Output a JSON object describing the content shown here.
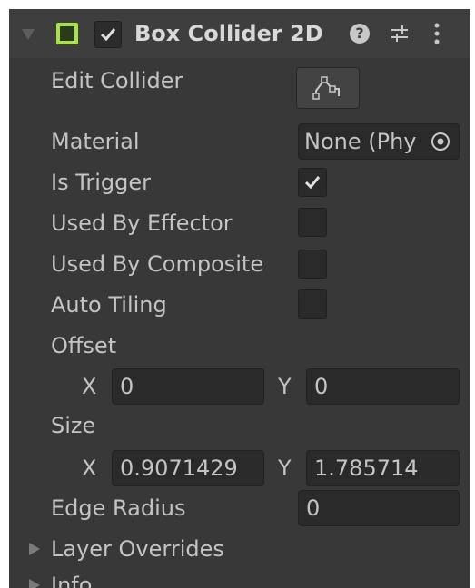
{
  "component": {
    "title": "Box Collider 2D",
    "icons": [
      "expand-triangle-icon",
      "collider-icon",
      "enabled-checkbox",
      "help-icon",
      "presets-icon",
      "more-menu-icon"
    ]
  },
  "edit_collider": {
    "label": "Edit Collider",
    "button_icon": "edit-shape-icon"
  },
  "material": {
    "label": "Material",
    "value": "None (Phy",
    "picker_icon": "object-picker-icon"
  },
  "is_trigger": {
    "label": "Is Trigger",
    "checked": true
  },
  "used_by_effector": {
    "label": "Used By Effector",
    "checked": false
  },
  "used_by_composite": {
    "label": "Used By Composite",
    "checked": false
  },
  "auto_tiling": {
    "label": "Auto Tiling",
    "checked": false
  },
  "offset": {
    "label": "Offset",
    "x_label": "X",
    "x": "0",
    "y_label": "Y",
    "y": "0"
  },
  "size": {
    "label": "Size",
    "x_label": "X",
    "x": "0.9071429",
    "y_label": "Y",
    "y": "1.785714"
  },
  "edge_radius": {
    "label": "Edge Radius",
    "value": "0"
  },
  "foldouts": [
    {
      "label": "Layer Overrides"
    },
    {
      "label": "Info"
    }
  ],
  "colors": {
    "panel": "#383838",
    "header": "#3e3e3e",
    "field": "#2a2a2a",
    "text": "#c4c4c4",
    "accent": "#a7e24a"
  }
}
